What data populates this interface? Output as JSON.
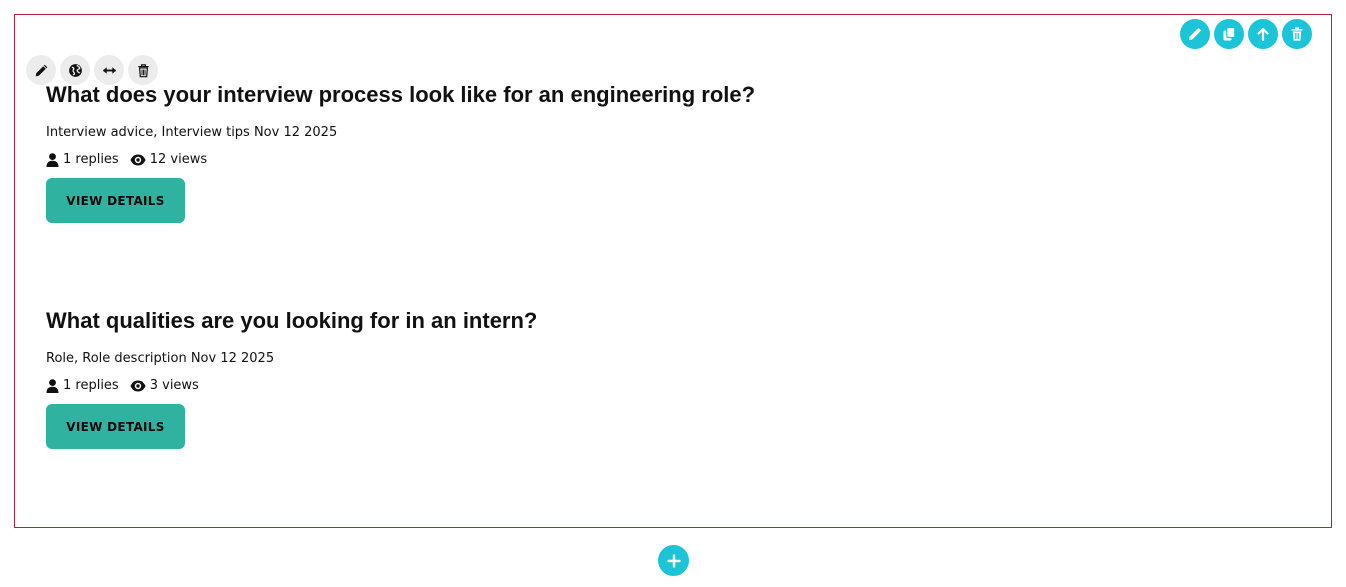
{
  "top_tools": [
    "pencil-icon",
    "copy-icon",
    "arrow-up-icon",
    "trash-icon"
  ],
  "item_tools": [
    "pencil-icon",
    "globe-icon",
    "resize-horizontal-icon",
    "trash-icon"
  ],
  "posts": [
    {
      "title": "What does your interview process look like for an engineering role?",
      "meta": "Interview advice, Interview tips Nov 12 2025",
      "replies": "1 replies",
      "views": "12 views",
      "button": "VIEW DETAILS"
    },
    {
      "title": "What qualities are you looking for in an intern?",
      "meta": "Role, Role description Nov 12 2025",
      "replies": "1 replies",
      "views": "3 views",
      "button": "VIEW DETAILS"
    }
  ],
  "add_icon": "plus-icon",
  "colors": {
    "accent": "#1cc4d8",
    "button": "#2fb3a0",
    "frame_border": "#b0233d"
  }
}
